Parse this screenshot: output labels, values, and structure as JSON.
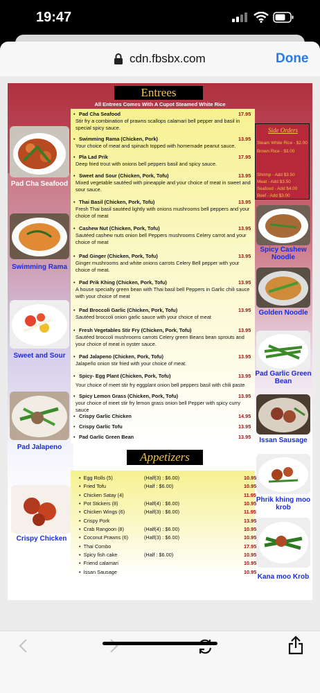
{
  "status_bar": {
    "time": "19:47"
  },
  "browser": {
    "host": "cdn.fbsbx.com",
    "done_label": "Done"
  },
  "menu": {
    "entrees_title": "Entrees",
    "entrees_subtitle": "All Entrees Comes With A Cupot Steamed White Rice",
    "entrees": [
      {
        "name": "Pad Cha Seafood",
        "desc": "Stir fry a combination of prawns scallops calamari bell pepper and basil in special spicy sauce.",
        "price": "17.95"
      },
      {
        "name": "Swimming Rama (Chicken, Pork)",
        "desc": "Your choice of meat and spinach topped with homemade peanut sauce.",
        "price": "13.95"
      },
      {
        "name": "Pla Lad Prik",
        "desc": "Deep fried trout with onions bell peppers basil and spicy sauce.",
        "price": "17.95"
      },
      {
        "name": "Sweet and Sour (Chicken, Pork, Tofu)",
        "desc": "Mixed vegetable sautéed with pineapple and your choice of meat in sweet and sour sauce.",
        "price": "13.95"
      },
      {
        "name": "Thai Basil (Chicken, Pork, Tofu)",
        "desc": "Fresh Thai basil sautéed lightly with onions mushrooms bell peppers and your choice of meat",
        "price": "13.95"
      },
      {
        "name": "Cashew Nut (Chicken, Pork, Tofu)",
        "desc": "Sautéed cashew nuts onion bell Peppers mushrooms Celery carrot and your choice of meat",
        "price": "13.95"
      },
      {
        "name": "Pad Ginger (Chicken, Pork, Tofu)",
        "desc": "Ginger mushrooms and white onions carrots Celery Bell pepper with your choice of meat.",
        "price": "13.95"
      },
      {
        "name": "Pad Prik Khing  (Chicken, Pork, Tofu)",
        "desc": "A house specialty green bean with Thai basil bell Peppers in Garlic chili sauce with your choice of meat",
        "price": "13.95"
      },
      {
        "name": "Pad Broccoli Garlic (Chicken, Pork, Tofu)",
        "desc": "Sautéed broccoli onion garlic sauce with your choice of meat",
        "price": "13.95"
      },
      {
        "name": "Fresh Vegetables Stir Fry (Chicken, Pork, Tofu)",
        "desc": "Sautéed broccoli mushrooms carrots Celery green Beans bean sprouts and your choice of meat in oyster sauce.",
        "price": "13.95"
      },
      {
        "name": "Pad Jalapeno  (Chicken, Pork, Tofu)",
        "desc": "Jalapeño onion stir fried with your choice of meat.",
        "price": "13.95"
      },
      {
        "name": "Spicy- Egg Plant (Chicken, Pork, Tofu)",
        "desc": "Your choice of meet stir fry eggplant onion bell peppers basil with chili paste",
        "price": "13.95"
      },
      {
        "name": "Spicy Lemon Grass (Chicken, Pork, Tofu)",
        "desc": "your choice of meet stir fry lemon grass onion bell Pepper with spicy curry sauce",
        "price": "13.95"
      },
      {
        "name": "Crispy Garlic Chicken",
        "desc": "",
        "price": "14.95"
      },
      {
        "name": "Crispy Garlic Tofu",
        "desc": "",
        "price": "13.95"
      },
      {
        "name": "Pad  Garlic Green  Bean",
        "desc": "",
        "price": "13.95"
      }
    ],
    "side_orders": {
      "title": "Side Orders",
      "lines": [
        "Steam White Rice - $2.00",
        "Brown Rice - $3.00",
        "Shrimp - Add $3.50",
        "Meat - Add $3.50",
        "Seafood - Add $4.00",
        "Beef - Add $3.00"
      ]
    },
    "left_captions": [
      "Pad Cha Seafood",
      "Swimming Rama",
      "Sweet and Sour",
      "Pad Jalapeno",
      "Crispy Chicken"
    ],
    "right_captions": [
      "Spicy Cashew Noodle",
      "Golden Noodle",
      "Pad  Garlic Green  Bean",
      "Issan Sausage",
      "Phrik khing moo krob",
      "Kana moo Krob"
    ],
    "appetizers_title": "Appetizers",
    "appetizers": [
      {
        "name": "Egg Rolls (5)",
        "half": "(Half(3) : $6.00)",
        "price": "10.95"
      },
      {
        "name": "Fried Tofu",
        "half": "(Half : $6.00)",
        "price": "10.95"
      },
      {
        "name": "Chicken Satay (4)",
        "half": "",
        "price": "11.95"
      },
      {
        "name": "Pot Stickers (8)",
        "half": "(Half(4) : $6.00)",
        "price": "10.95"
      },
      {
        "name": "Chicken Wings (6)",
        "half": "(Half(3) : $6.00)",
        "price": "11.95"
      },
      {
        "name": "Crispy Pork",
        "half": "",
        "price": "13.95"
      },
      {
        "name": "Crab Rangoon (8)",
        "half": "(Half(4) : $6.00)",
        "price": "10.95"
      },
      {
        "name": "Coconut Prawns (6)",
        "half": "(Half(3) : $6.00)",
        "price": "10.95"
      },
      {
        "name": "Thai Combo",
        "half": "",
        "price": "17.95"
      },
      {
        "name": "Spicy fish cake",
        "half": "(Half : $6.00)",
        "price": "10.95"
      },
      {
        "name": "Friend calamari",
        "half": "",
        "price": "10.95"
      },
      {
        "name": "Issan Sausage",
        "half": "",
        "price": "10.95"
      }
    ]
  }
}
